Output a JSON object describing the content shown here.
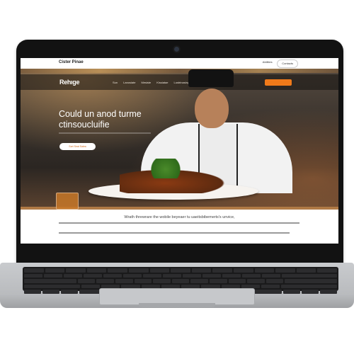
{
  "browser": {
    "brand": "Cister Pinae",
    "top_nav": [
      "Abilities",
      "Mine",
      "Trie"
    ],
    "contact_label": "Contacts"
  },
  "hero": {
    "logo": "Rehıge",
    "nav_links": [
      "Sun",
      "Lanosiate",
      "Mesiste",
      "Kissiatae",
      "Lustrinasing"
    ],
    "title": "Could un anod turme ctinsoucluifie",
    "button_label": "Sort Seat Salea"
  },
  "content": {
    "section_title": "Wrath threwrare the wobile beyeaer tu uaeitsbibemerts's unvice,"
  },
  "colors": {
    "accent": "#f07a1a",
    "frame": "#121212",
    "laptop_base": "#c9cbce"
  },
  "icons": {
    "camera": "camera-icon",
    "contact": "contact-icon"
  }
}
